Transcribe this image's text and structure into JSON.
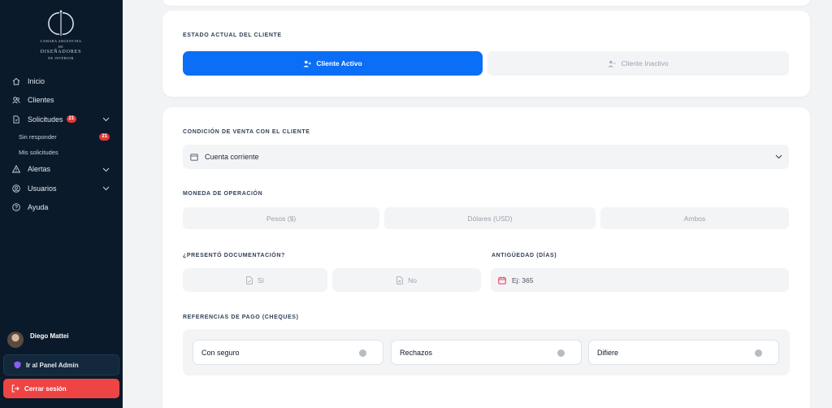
{
  "brand": {
    "logo_letters": "CD",
    "logo_line1": "CAMARA ARGENTINA",
    "logo_line2": "DE",
    "logo_line3": "DISEÑADORES",
    "logo_line4": "DE INTERIOR"
  },
  "sidebar": {
    "items": [
      {
        "label": "Inicio",
        "icon": "home-icon"
      },
      {
        "label": "Clientes",
        "icon": "users-icon"
      },
      {
        "label": "Solicitudes",
        "icon": "file-icon",
        "badge": "21"
      },
      {
        "label": "Alertas",
        "icon": "alert-icon"
      },
      {
        "label": "Usuarios",
        "icon": "user-circle-icon"
      },
      {
        "label": "Ayuda",
        "icon": "help-icon"
      }
    ],
    "sub_items": [
      {
        "label": "Sin responder",
        "badge": "21"
      },
      {
        "label": "Mis solicitudes"
      }
    ],
    "user_name": "Diego Mattei",
    "admin_button": "Ir al Panel Admin",
    "logout_button": "Cerrar sesión"
  },
  "estado": {
    "label": "ESTADO ACTUAL DEL CLIENTE",
    "active_option": "Cliente Activo",
    "inactive_option": "Cliente Inactivo"
  },
  "condicion": {
    "label": "CONDICIÓN DE VENTA CON EL CLIENTE",
    "selected": "Cuenta corriente"
  },
  "moneda": {
    "label": "MONEDA DE OPERACIÓN",
    "options": [
      "Pesos ($)",
      "Dólares (USD)",
      "Ambos"
    ]
  },
  "documentacion": {
    "label": "¿PRESENTÓ DOCUMENTACIÓN?",
    "yes": "Sí",
    "no": "No"
  },
  "antiguedad": {
    "label": "ANTIGÜEDAD (DÍAS)",
    "placeholder": "Ej: 365"
  },
  "referencias": {
    "label": "REFERENCIAS DE PAGO (CHEQUES)",
    "options": [
      "Con seguro",
      "Rechazos",
      "Difiere"
    ]
  },
  "colors": {
    "sidebar_bg": "#0b1a2b",
    "accent": "#0b6ef6",
    "danger": "#ef4444",
    "badge": "#e53935"
  }
}
